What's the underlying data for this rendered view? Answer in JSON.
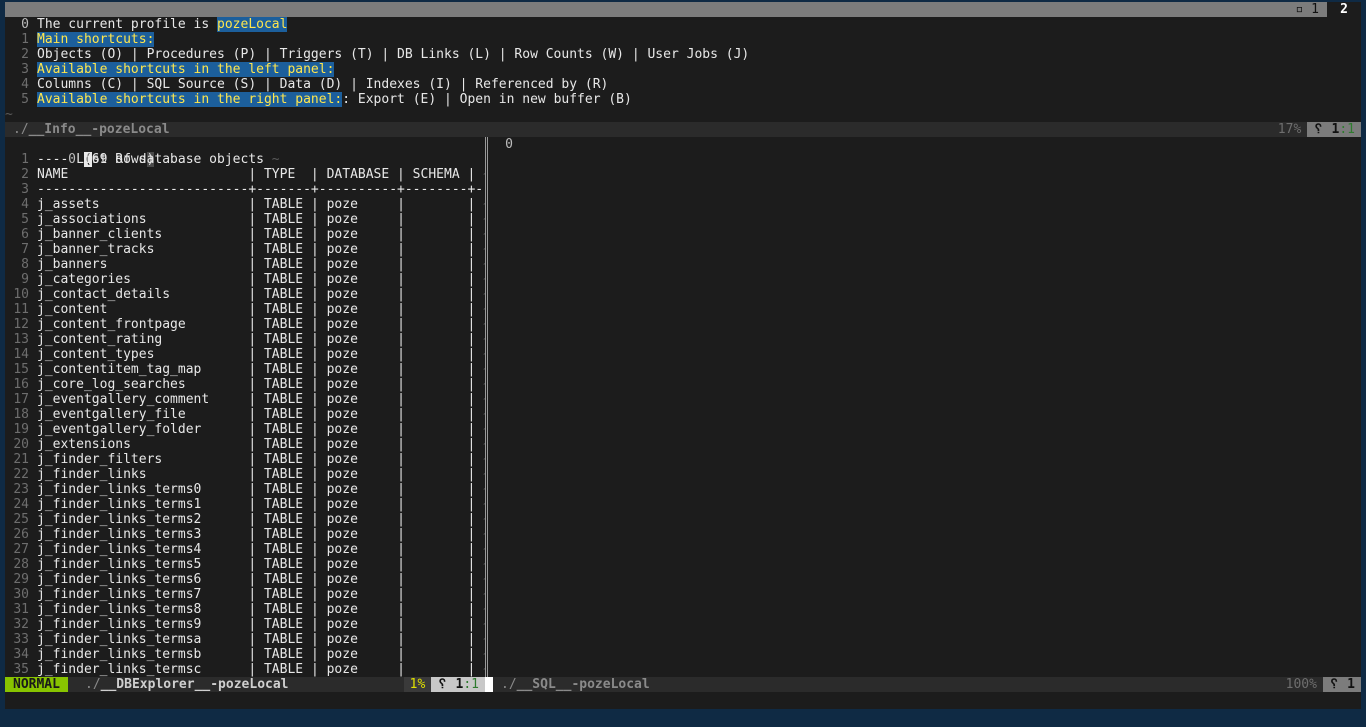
{
  "tabline": {
    "count_label": "▫ 1",
    "current_tab": "2"
  },
  "info_pane": {
    "lines": [
      {
        "n": "0",
        "segments": [
          {
            "t": "The current profile is ",
            "c": ""
          },
          {
            "t": "pozeLocal",
            "c": "hl"
          }
        ]
      },
      {
        "n": "1",
        "segments": [
          {
            "t": "Main shortcuts:",
            "c": "hl"
          }
        ]
      },
      {
        "n": "2",
        "segments": [
          {
            "t": "Objects (O) | Procedures (P) | Triggers (T) | DB Links (L) | Row Counts (W) | User Jobs (J)",
            "c": ""
          }
        ]
      },
      {
        "n": "3",
        "segments": [
          {
            "t": "Available shortcuts in the left panel:",
            "c": "hl"
          }
        ]
      },
      {
        "n": "4",
        "segments": [
          {
            "t": "Columns (C) | SQL Source (S) | Data (D) | Indexes (I) | Referenced by (R)",
            "c": ""
          }
        ]
      },
      {
        "n": "5",
        "segments": [
          {
            "t": "Available shortcuts in the right panel:",
            "c": "hl"
          },
          {
            "t": ": Export (E) | Open in new buffer (B)",
            "c": ""
          }
        ]
      }
    ],
    "tilde": "~",
    "status": {
      "prefix": "./",
      "name": "__Info__-pozeLocal",
      "percent": "17%",
      "branch_icon": "␦",
      "line": "1",
      "col": ":1"
    }
  },
  "explorer_pane": {
    "first_line": {
      "n": "0",
      "cursor": "(",
      "text": "69 Rows",
      "close": ")"
    },
    "header_lines": [
      {
        "n": "1",
        "text": "---- List of database objects"
      },
      {
        "n": "2",
        "text": "NAME                       | TYPE  | DATABASE | SCHEMA |"
      },
      {
        "n": "3",
        "text": "---------------------------+-------+----------+--------+-"
      }
    ],
    "rows": [
      {
        "n": "4",
        "name": "j_assets"
      },
      {
        "n": "5",
        "name": "j_associations"
      },
      {
        "n": "6",
        "name": "j_banner_clients"
      },
      {
        "n": "7",
        "name": "j_banner_tracks"
      },
      {
        "n": "8",
        "name": "j_banners"
      },
      {
        "n": "9",
        "name": "j_categories"
      },
      {
        "n": "10",
        "name": "j_contact_details"
      },
      {
        "n": "11",
        "name": "j_content"
      },
      {
        "n": "12",
        "name": "j_content_frontpage"
      },
      {
        "n": "13",
        "name": "j_content_rating"
      },
      {
        "n": "14",
        "name": "j_content_types"
      },
      {
        "n": "15",
        "name": "j_contentitem_tag_map"
      },
      {
        "n": "16",
        "name": "j_core_log_searches"
      },
      {
        "n": "17",
        "name": "j_eventgallery_comment"
      },
      {
        "n": "18",
        "name": "j_eventgallery_file"
      },
      {
        "n": "19",
        "name": "j_eventgallery_folder"
      },
      {
        "n": "20",
        "name": "j_extensions"
      },
      {
        "n": "21",
        "name": "j_finder_filters"
      },
      {
        "n": "22",
        "name": "j_finder_links"
      },
      {
        "n": "23",
        "name": "j_finder_links_terms0"
      },
      {
        "n": "24",
        "name": "j_finder_links_terms1"
      },
      {
        "n": "25",
        "name": "j_finder_links_terms2"
      },
      {
        "n": "26",
        "name": "j_finder_links_terms3"
      },
      {
        "n": "27",
        "name": "j_finder_links_terms4"
      },
      {
        "n": "28",
        "name": "j_finder_links_terms5"
      },
      {
        "n": "29",
        "name": "j_finder_links_terms6"
      },
      {
        "n": "30",
        "name": "j_finder_links_terms7"
      },
      {
        "n": "31",
        "name": "j_finder_links_terms8"
      },
      {
        "n": "32",
        "name": "j_finder_links_terms9"
      },
      {
        "n": "33",
        "name": "j_finder_links_termsa"
      },
      {
        "n": "34",
        "name": "j_finder_links_termsb"
      },
      {
        "n": "35",
        "name": "j_finder_links_termsc"
      }
    ],
    "row_type": "TABLE",
    "row_database": "poze",
    "status": {
      "mode": "NORMAL",
      "prefix": "./",
      "name": "__DBExplorer__-pozeLocal",
      "percent": "1%",
      "branch_icon": "␦",
      "line": "1",
      "col": ":1"
    }
  },
  "sql_pane": {
    "first_line": "0",
    "tilde": "~",
    "status": {
      "prefix": "./",
      "name": "__SQL__-pozeLocal",
      "percent": "100%",
      "branch_icon": "␦",
      "line": "1"
    }
  }
}
